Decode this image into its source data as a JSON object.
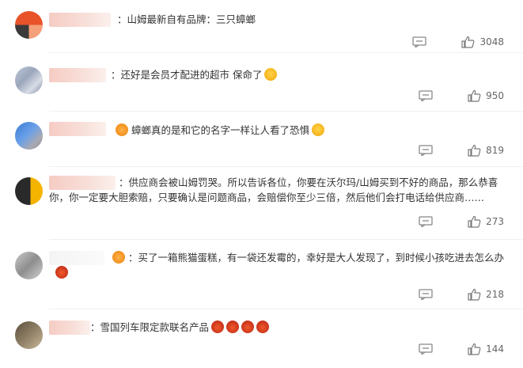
{
  "comments": [
    {
      "text": "：山姆最新自有品牌：三只蟑螂",
      "likes": "3048",
      "emoji": ""
    },
    {
      "text": "：还好是会员才配进的超市 保命了",
      "likes": "950",
      "emoji": "cry-emoji"
    },
    {
      "text": "蟑螂真的是和它的名字一样让人看了恐惧",
      "likes": "819",
      "emoji": "cry-emoji"
    },
    {
      "text": "：供应商会被山姆罚哭。所以告诉各位，你要在沃尔玛/山姆买到不好的商品，那么恭喜你，你一定要大胆索赔，只要确认是问题商品，会赔偿你至少三倍，然后他们会打电话给供应商……",
      "likes": "273",
      "emoji": ""
    },
    {
      "text": "：买了一箱熊猫蛋糕，有一袋还发霉的，幸好是大人发现了，到时候小孩吃进去怎么办",
      "likes": "218",
      "emoji": "angry-emoji"
    },
    {
      "text": "：雪国列车限定款联名产品",
      "likes": "144",
      "emoji": "fire-emoji"
    }
  ],
  "icons": {
    "reply": "comment-icon",
    "like": "thumbs-up-icon"
  },
  "colors": {
    "text": "#333333",
    "muted": "#666666",
    "blur": "#f4c6bd"
  }
}
